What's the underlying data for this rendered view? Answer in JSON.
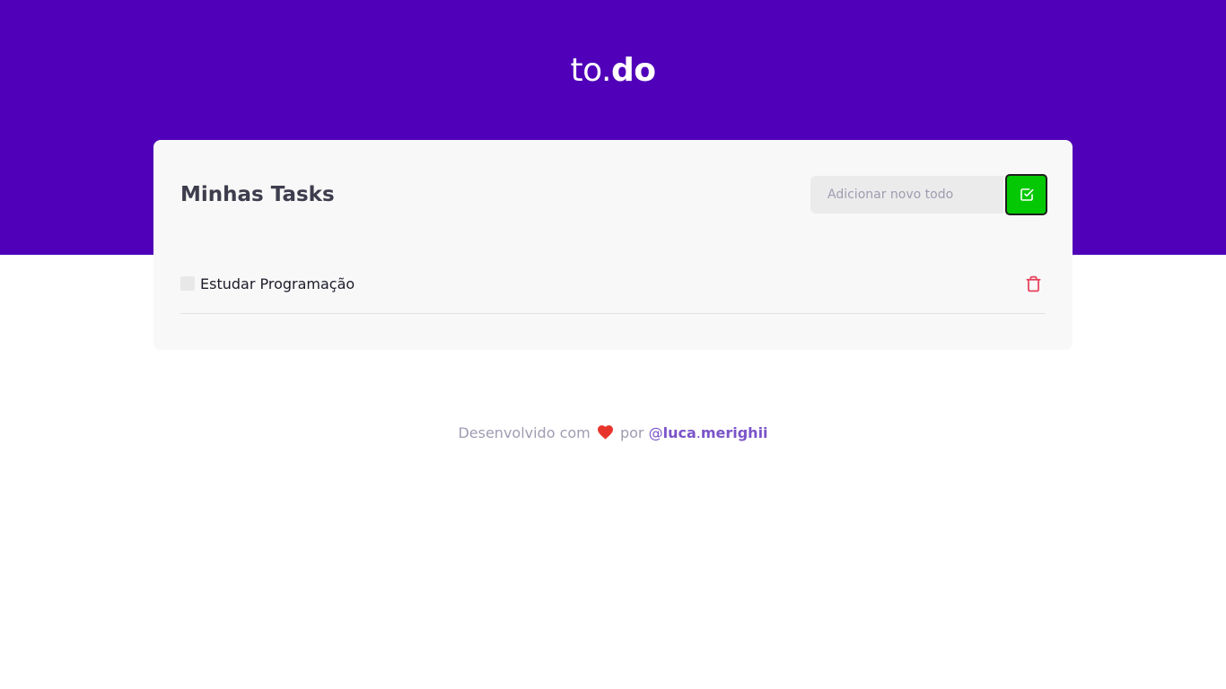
{
  "header": {
    "logo_light": "to.",
    "logo_bold": "do",
    "background_color": "#5000b8"
  },
  "card": {
    "title": "Minhas Tasks",
    "new_todo": {
      "placeholder": "Adicionar novo todo",
      "value": ""
    },
    "add_button": {
      "icon": "check-square-icon",
      "color": "#04c804"
    }
  },
  "tasks": [
    {
      "title": "Estudar Programação",
      "completed": false,
      "delete_icon": "trash-icon",
      "delete_color": "#e83f5b"
    }
  ],
  "footer": {
    "text_before": "Desenvolvido com",
    "heart_icon": "heart-icon",
    "text_por": "por",
    "handle_at": "@",
    "handle_first": "luca",
    "handle_dot": ".",
    "handle_last": "merighii"
  }
}
